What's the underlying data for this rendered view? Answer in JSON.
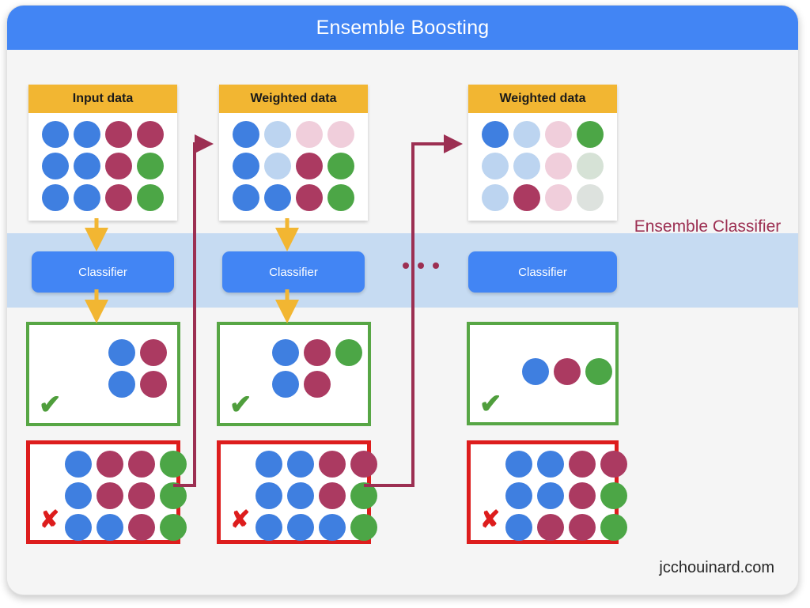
{
  "header": {
    "title": "Ensemble Boosting"
  },
  "colors": {
    "blue": "#3f7fe0",
    "blue_light": "#bcd4f0",
    "maroon": "#ab3a61",
    "maroon_light": "#f0cedb",
    "green": "#4ca646",
    "green_light": "#d6e2d6",
    "grey_light": "#dde2de",
    "accent_blue": "#4285f4",
    "accent_yellow": "#f2b632",
    "accent_maroon": "#9c2f52",
    "accent_green": "#57a645",
    "accent_red": "#dd1d1d",
    "band": "#c6dbf2"
  },
  "ensemble": {
    "label": "Ensemble Classifier",
    "ellipsis": "..."
  },
  "columns": [
    {
      "panel_title": "Input data",
      "panel_cols": 4,
      "panel_dots": [
        "blue",
        "blue",
        "maroon",
        "maroon",
        "blue",
        "blue",
        "maroon",
        "green",
        "blue",
        "blue",
        "maroon",
        "green"
      ],
      "classifier_label": "Classifier",
      "correct": {
        "cols": 2,
        "dots": [
          "blue",
          "maroon",
          "blue",
          "maroon"
        ],
        "mark": "✔"
      },
      "wrong": {
        "cols": 4,
        "dots": [
          "blue",
          "maroon",
          "maroon",
          "green",
          "blue",
          "maroon",
          "maroon",
          "green",
          "blue",
          "blue",
          "maroon",
          "green"
        ],
        "mark": "✘"
      }
    },
    {
      "panel_title": "Weighted data",
      "panel_cols": 4,
      "panel_dots": [
        "blue",
        "blue_light",
        "maroon_light",
        "maroon_light",
        "blue",
        "blue_light",
        "maroon",
        "green",
        "blue",
        "blue",
        "maroon",
        "green"
      ],
      "classifier_label": "Classifier",
      "correct": {
        "cols": 3,
        "dots": [
          "blue",
          "maroon",
          "green",
          "blue",
          "maroon",
          "none"
        ],
        "mark": "✔"
      },
      "wrong": {
        "cols": 4,
        "dots": [
          "blue",
          "blue",
          "maroon",
          "maroon",
          "blue",
          "blue",
          "maroon",
          "green",
          "blue",
          "blue",
          "blue",
          "green"
        ],
        "mark": "✘"
      }
    },
    {
      "panel_title": "Weighted data",
      "panel_cols": 4,
      "panel_dots": [
        "blue",
        "blue_light",
        "maroon_light",
        "green",
        "blue_light",
        "blue_light",
        "maroon_light",
        "green_light",
        "blue_light",
        "maroon",
        "maroon_light",
        "grey_light"
      ],
      "classifier_label": "Classifier",
      "correct": {
        "cols": 3,
        "dots": [
          "blue",
          "maroon",
          "green"
        ],
        "mark": "✔"
      },
      "wrong": {
        "cols": 4,
        "dots": [
          "blue",
          "blue",
          "maroon",
          "maroon",
          "blue",
          "blue",
          "maroon",
          "green",
          "blue",
          "maroon",
          "maroon",
          "green"
        ],
        "mark": "✘"
      }
    }
  ],
  "watermark": "jcchouinard.com"
}
